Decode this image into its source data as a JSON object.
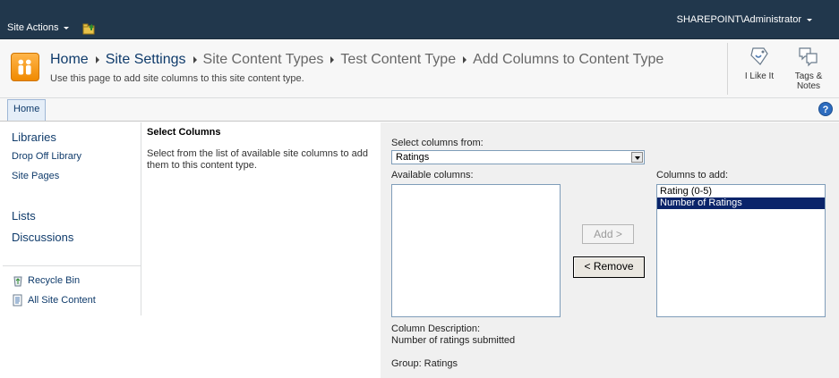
{
  "topbar": {
    "site_actions_label": "Site Actions",
    "user_label": "SHAREPOINT\\Administrator"
  },
  "title_area": {
    "breadcrumb": [
      "Home",
      "Site Settings",
      "Site Content Types",
      "Test Content Type",
      "Add Columns to Content Type"
    ],
    "subtitle": "Use this page to add site columns to this site content type.",
    "like_label": "I Like It",
    "tags_label_1": "Tags &",
    "tags_label_2": "Notes"
  },
  "tabs": {
    "home": "Home"
  },
  "help_label": "?",
  "leftnav": {
    "libraries_heading": "Libraries",
    "library_items": [
      "Drop Off Library",
      "Site Pages"
    ],
    "lists_heading": "Lists",
    "discussions_heading": "Discussions",
    "recycle_bin": "Recycle Bin",
    "all_site_content": "All Site Content"
  },
  "section": {
    "title": "Select Columns",
    "description": "Select from the list of available site columns to add them to this content type."
  },
  "form": {
    "select_from_label": "Select columns from:",
    "select_from_value": "Ratings",
    "available_label": "Available columns:",
    "available_items": [],
    "to_add_label": "Columns to add:",
    "to_add_items": [
      "Rating (0-5)",
      "Number of Ratings"
    ],
    "to_add_selected": "Number of Ratings",
    "add_button": "Add >",
    "remove_button": "< Remove",
    "column_description_label": "Column Description:",
    "column_description_value": "Number of ratings submitted",
    "group_text": "Group: Ratings"
  },
  "colors": {
    "topbar": "#21374c",
    "link": "#0f3b6b",
    "selection": "#0a246a",
    "panel": "#f0f0f0"
  }
}
